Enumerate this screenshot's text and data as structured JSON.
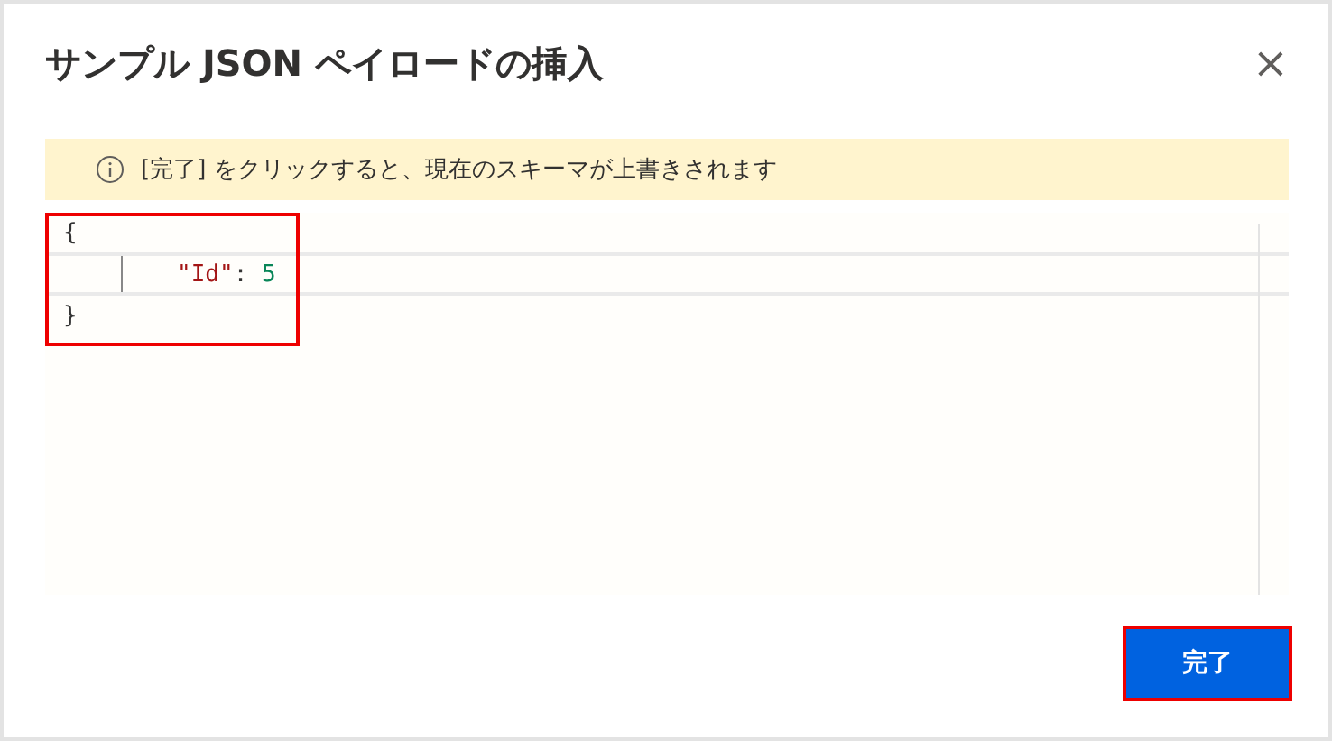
{
  "dialog": {
    "title": "サンプル JSON ペイロードの挿入",
    "close": "×"
  },
  "notice": {
    "text": "[完了] をクリックすると、現在のスキーマが上書きされます"
  },
  "editor": {
    "lines": [
      {
        "tokens": [
          {
            "kind": "punct",
            "text": "{"
          }
        ],
        "current": false
      },
      {
        "tokens": [
          {
            "kind": "key",
            "text": "\"Id\""
          },
          {
            "kind": "punct",
            "text": ": "
          },
          {
            "kind": "number",
            "text": "5"
          }
        ],
        "current": true
      },
      {
        "tokens": [
          {
            "kind": "punct",
            "text": "}"
          }
        ],
        "current": false
      }
    ]
  },
  "buttons": [
    {
      "label": "完了",
      "kind": "primary"
    }
  ]
}
